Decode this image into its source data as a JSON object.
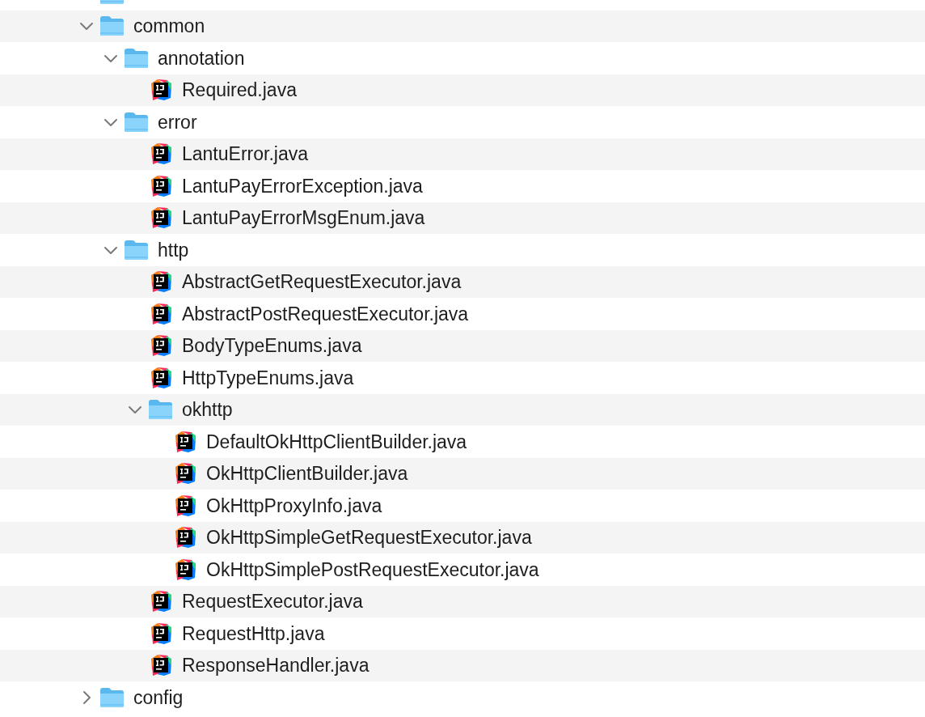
{
  "tree": [
    {
      "kind": "folder"
    },
    {
      "kind": "folder",
      "name": "common",
      "expanded": true,
      "children": [
        {
          "kind": "folder",
          "name": "annotation",
          "expanded": true,
          "children": [
            {
              "kind": "java",
              "name": "Required.java"
            }
          ]
        },
        {
          "kind": "folder",
          "name": "error",
          "expanded": true,
          "children": [
            {
              "kind": "java",
              "name": "LantuError.java"
            },
            {
              "kind": "java",
              "name": "LantuPayErrorException.java"
            },
            {
              "kind": "java",
              "name": "LantuPayErrorMsgEnum.java"
            }
          ]
        },
        {
          "kind": "folder",
          "name": "http",
          "expanded": true,
          "children": [
            {
              "kind": "java",
              "name": "AbstractGetRequestExecutor.java"
            },
            {
              "kind": "java",
              "name": "AbstractPostRequestExecutor.java"
            },
            {
              "kind": "java",
              "name": "BodyTypeEnums.java"
            },
            {
              "kind": "java",
              "name": "HttpTypeEnums.java"
            },
            {
              "kind": "folder",
              "name": "okhttp",
              "expanded": true,
              "children": [
                {
                  "kind": "java",
                  "name": "DefaultOkHttpClientBuilder.java"
                },
                {
                  "kind": "java",
                  "name": "OkHttpClientBuilder.java"
                },
                {
                  "kind": "java",
                  "name": "OkHttpProxyInfo.java"
                },
                {
                  "kind": "java",
                  "name": "OkHttpSimpleGetRequestExecutor.java"
                },
                {
                  "kind": "java",
                  "name": "OkHttpSimplePostRequestExecutor.java"
                }
              ]
            },
            {
              "kind": "java",
              "name": "RequestExecutor.java"
            },
            {
              "kind": "java",
              "name": "RequestHttp.java"
            },
            {
              "kind": "java",
              "name": "ResponseHandler.java"
            }
          ]
        }
      ]
    },
    {
      "kind": "folder",
      "name": "config",
      "expanded": false
    }
  ]
}
